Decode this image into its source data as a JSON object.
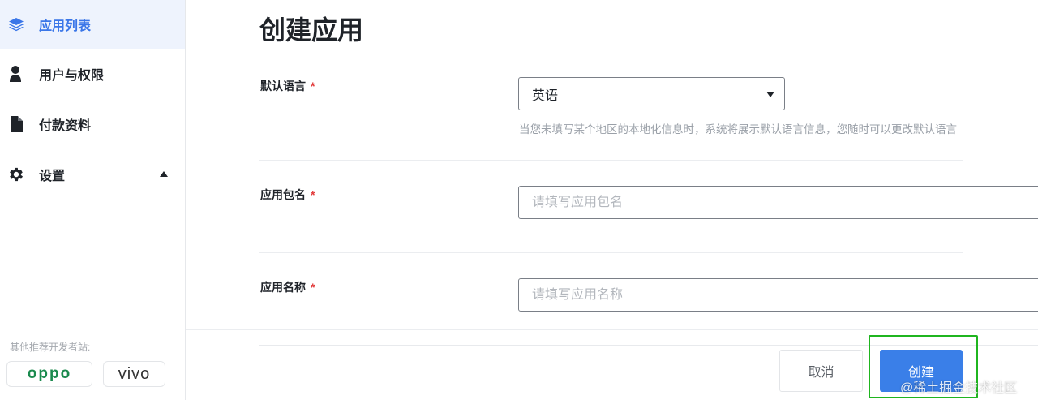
{
  "sidebar": {
    "items": [
      {
        "label": "应用列表",
        "icon": "layers-icon",
        "active": true
      },
      {
        "label": "用户与权限",
        "icon": "user-icon",
        "active": false
      },
      {
        "label": "付款资料",
        "icon": "document-icon",
        "active": false
      },
      {
        "label": "设置",
        "icon": "gear-icon",
        "active": false,
        "expanded": true
      }
    ],
    "recommend_label": "其他推荐开发者站:",
    "partners": [
      "oppo",
      "vivo"
    ]
  },
  "main": {
    "title": "创建应用",
    "required_mark": "*",
    "fields": {
      "language": {
        "label": "默认语言",
        "value": "英语",
        "hint": "当您未填写某个地区的本地化信息时，系统将展示默认语言信息，您随时可以更改默认语言"
      },
      "package": {
        "label": "应用包名",
        "value": "",
        "placeholder": "请填写应用包名"
      },
      "app_name": {
        "label": "应用名称",
        "value": "",
        "placeholder": "请填写应用名称"
      }
    }
  },
  "footer": {
    "cancel_label": "取消",
    "create_label": "创建",
    "watermark": "@稀土掘金技术社区"
  },
  "colors": {
    "accent": "#3a7fe8",
    "active_bg": "#eef3fd",
    "required": "#e23a3a",
    "highlight_box": "#1fb51f",
    "oppo_green": "#1b8a4e"
  }
}
